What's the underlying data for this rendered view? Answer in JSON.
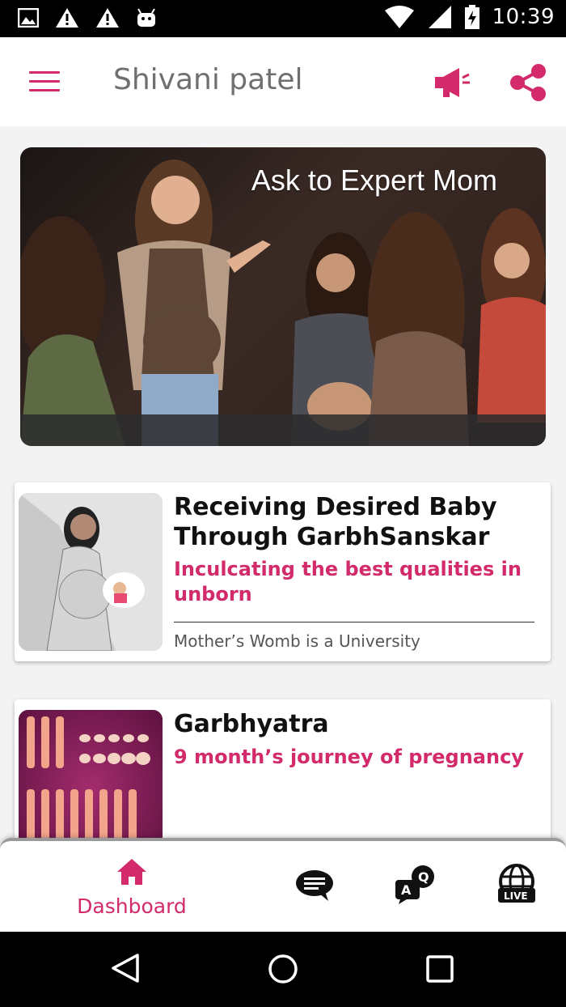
{
  "status_bar": {
    "time": "10:39",
    "icons": [
      "image-icon",
      "warning-icon",
      "warning-icon",
      "android-icon",
      "wifi-icon",
      "signal-icon",
      "battery-charging-icon"
    ]
  },
  "app_bar": {
    "title": "Shivani patel",
    "icons": [
      "menu-icon",
      "megaphone-icon",
      "share-icon"
    ],
    "accent_color": "#d22a6b"
  },
  "banner": {
    "title": "Ask to Expert Mom"
  },
  "cards": [
    {
      "title": "Receiving Desired Baby Through GarbhSanskar",
      "subtitle": "Inculcating the best qualities in unborn",
      "caption": "Mother’s Womb is a University"
    },
    {
      "title": "Garbhyatra",
      "subtitle": "9 month’s journey of pregnancy"
    }
  ],
  "bottom_nav": {
    "items": [
      {
        "label": "Dashboard",
        "icon": "home-icon",
        "active": true
      },
      {
        "label": "",
        "icon": "chat-icon"
      },
      {
        "label": "",
        "icon": "question-answer-icon"
      },
      {
        "label": "",
        "icon": "live-globe-icon"
      }
    ]
  },
  "system_nav": {
    "icons": [
      "back-icon",
      "home-circle-icon",
      "recents-icon"
    ]
  }
}
